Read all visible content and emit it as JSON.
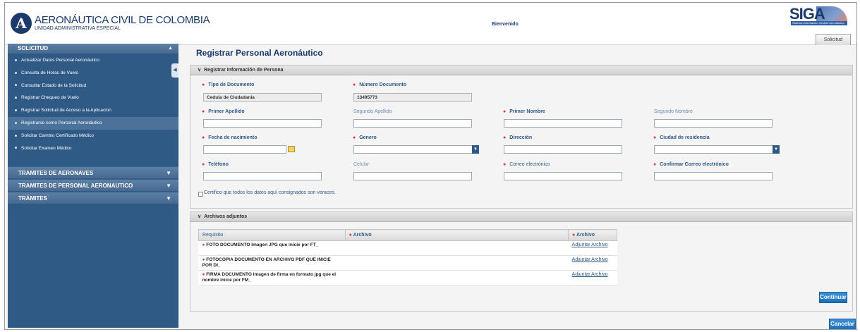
{
  "header": {
    "org_title": "AERONÁUTICA CIVIL DE COLOMBIA",
    "org_subtitle": "UNIDAD ADMINISTRATIVA ESPECIAL",
    "welcome": "Bienvenido",
    "brand": "SIGA",
    "brand_sub": "Sistema Información Gestión Aeronáutica",
    "tab_label": "Solicitud"
  },
  "sidebar": {
    "section_title": "SOLICITUD",
    "items": [
      {
        "label": "Actualizar Datos Personal Aeronáutico"
      },
      {
        "label": "Consulta de Horas de Vuelo"
      },
      {
        "label": "Consultar Estado de la Solicitud"
      },
      {
        "label": "Registrar Chequeo de Vuelo"
      },
      {
        "label": "Registrar Solicitud de Acceso a la Aplicacion"
      },
      {
        "label": "Registrarse como Personal Aeronáutico"
      },
      {
        "label": "Solicitar Cambio Certificado Médico"
      },
      {
        "label": "Solicitar Examen Médico"
      }
    ],
    "sections": [
      {
        "label": "TRAMITES DE AERONAVES"
      },
      {
        "label": "TRAMITES DE PERSONAL AERONAUTICO"
      },
      {
        "label": "TRÁMITES"
      }
    ]
  },
  "main": {
    "title": "Registrar Personal Aeronáutico",
    "person_panel_title": "Registrar Información de Persona",
    "fields": {
      "tipo_documento": {
        "label": "Tipo de Documento",
        "value": "Cedula de Ciudadania"
      },
      "numero_documento": {
        "label": "Número Documento",
        "value": "13495773"
      },
      "primer_apellido": {
        "label": "Primer Apellido"
      },
      "segundo_apellido": {
        "label": "Segundo Apellido"
      },
      "primer_nombre": {
        "label": "Primer Nombre"
      },
      "segundo_nombre": {
        "label": "Segundo Nombre"
      },
      "fecha_nacimiento": {
        "label": "Fecha de nacimiento"
      },
      "genero": {
        "label": "Genero"
      },
      "direccion": {
        "label": "Dirección"
      },
      "ciudad": {
        "label": "Ciudad de residencia"
      },
      "telefono": {
        "label": "Teléfono"
      },
      "celular": {
        "label": "Celular"
      },
      "correo": {
        "label": "Correo electrónico"
      },
      "confirmar_correo": {
        "label": "Confirmar Correo electrónico"
      }
    },
    "certify_text": "Certifico que todos los datos aquí consignados son veraces.",
    "attachments_title": "Archivos adjuntos",
    "table": {
      "headers": [
        "Requisito",
        "Archivo",
        "Archivo"
      ],
      "rows": [
        {
          "req": "FOTO DOCUMENTO Imagen JPG que inicie por FT_",
          "link": "Adjuntar Archivo"
        },
        {
          "req": "FOTOCOPIA DOCUMENTO EN ARCHIVO PDF QUE INICIE POR DI_",
          "link": "Adjuntar Archivo"
        },
        {
          "req": "FIRMA DOCUMENTO Imagen de firma en formato jpg que el nombre inicie por FM_",
          "link": "Adjuntar Archivo"
        }
      ]
    },
    "continue_label": "Continuar",
    "cancel_label": "Cancelar"
  },
  "colors": {
    "primary": "#2f5a86",
    "brand": "#1b3a6b",
    "required": "#d83a3a",
    "button": "#1d6fb8"
  }
}
